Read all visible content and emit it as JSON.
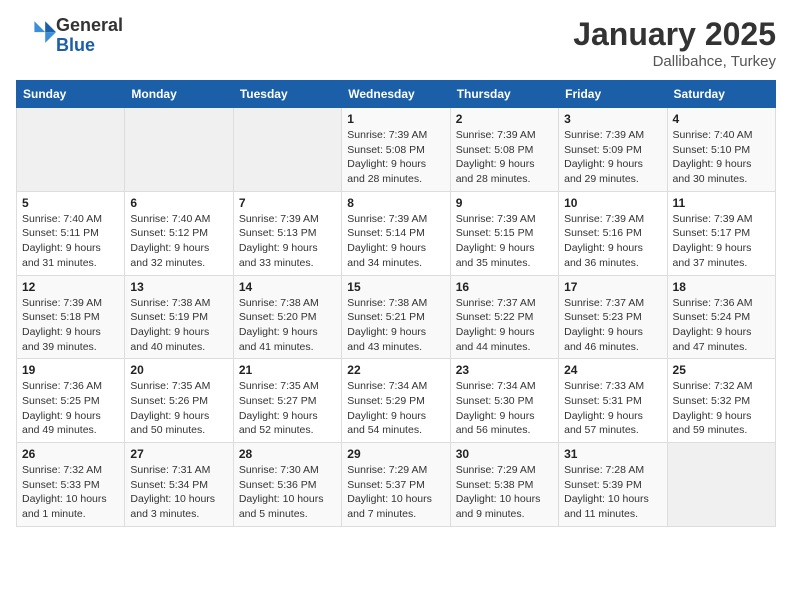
{
  "header": {
    "logo_line1": "General",
    "logo_line2": "Blue",
    "month": "January 2025",
    "location": "Dallibahce, Turkey"
  },
  "weekdays": [
    "Sunday",
    "Monday",
    "Tuesday",
    "Wednesday",
    "Thursday",
    "Friday",
    "Saturday"
  ],
  "weeks": [
    [
      {
        "day": "",
        "sunrise": "",
        "sunset": "",
        "daylight": ""
      },
      {
        "day": "",
        "sunrise": "",
        "sunset": "",
        "daylight": ""
      },
      {
        "day": "",
        "sunrise": "",
        "sunset": "",
        "daylight": ""
      },
      {
        "day": "1",
        "sunrise": "Sunrise: 7:39 AM",
        "sunset": "Sunset: 5:08 PM",
        "daylight": "Daylight: 9 hours and 28 minutes."
      },
      {
        "day": "2",
        "sunrise": "Sunrise: 7:39 AM",
        "sunset": "Sunset: 5:08 PM",
        "daylight": "Daylight: 9 hours and 28 minutes."
      },
      {
        "day": "3",
        "sunrise": "Sunrise: 7:39 AM",
        "sunset": "Sunset: 5:09 PM",
        "daylight": "Daylight: 9 hours and 29 minutes."
      },
      {
        "day": "4",
        "sunrise": "Sunrise: 7:40 AM",
        "sunset": "Sunset: 5:10 PM",
        "daylight": "Daylight: 9 hours and 30 minutes."
      }
    ],
    [
      {
        "day": "5",
        "sunrise": "Sunrise: 7:40 AM",
        "sunset": "Sunset: 5:11 PM",
        "daylight": "Daylight: 9 hours and 31 minutes."
      },
      {
        "day": "6",
        "sunrise": "Sunrise: 7:40 AM",
        "sunset": "Sunset: 5:12 PM",
        "daylight": "Daylight: 9 hours and 32 minutes."
      },
      {
        "day": "7",
        "sunrise": "Sunrise: 7:39 AM",
        "sunset": "Sunset: 5:13 PM",
        "daylight": "Daylight: 9 hours and 33 minutes."
      },
      {
        "day": "8",
        "sunrise": "Sunrise: 7:39 AM",
        "sunset": "Sunset: 5:14 PM",
        "daylight": "Daylight: 9 hours and 34 minutes."
      },
      {
        "day": "9",
        "sunrise": "Sunrise: 7:39 AM",
        "sunset": "Sunset: 5:15 PM",
        "daylight": "Daylight: 9 hours and 35 minutes."
      },
      {
        "day": "10",
        "sunrise": "Sunrise: 7:39 AM",
        "sunset": "Sunset: 5:16 PM",
        "daylight": "Daylight: 9 hours and 36 minutes."
      },
      {
        "day": "11",
        "sunrise": "Sunrise: 7:39 AM",
        "sunset": "Sunset: 5:17 PM",
        "daylight": "Daylight: 9 hours and 37 minutes."
      }
    ],
    [
      {
        "day": "12",
        "sunrise": "Sunrise: 7:39 AM",
        "sunset": "Sunset: 5:18 PM",
        "daylight": "Daylight: 9 hours and 39 minutes."
      },
      {
        "day": "13",
        "sunrise": "Sunrise: 7:38 AM",
        "sunset": "Sunset: 5:19 PM",
        "daylight": "Daylight: 9 hours and 40 minutes."
      },
      {
        "day": "14",
        "sunrise": "Sunrise: 7:38 AM",
        "sunset": "Sunset: 5:20 PM",
        "daylight": "Daylight: 9 hours and 41 minutes."
      },
      {
        "day": "15",
        "sunrise": "Sunrise: 7:38 AM",
        "sunset": "Sunset: 5:21 PM",
        "daylight": "Daylight: 9 hours and 43 minutes."
      },
      {
        "day": "16",
        "sunrise": "Sunrise: 7:37 AM",
        "sunset": "Sunset: 5:22 PM",
        "daylight": "Daylight: 9 hours and 44 minutes."
      },
      {
        "day": "17",
        "sunrise": "Sunrise: 7:37 AM",
        "sunset": "Sunset: 5:23 PM",
        "daylight": "Daylight: 9 hours and 46 minutes."
      },
      {
        "day": "18",
        "sunrise": "Sunrise: 7:36 AM",
        "sunset": "Sunset: 5:24 PM",
        "daylight": "Daylight: 9 hours and 47 minutes."
      }
    ],
    [
      {
        "day": "19",
        "sunrise": "Sunrise: 7:36 AM",
        "sunset": "Sunset: 5:25 PM",
        "daylight": "Daylight: 9 hours and 49 minutes."
      },
      {
        "day": "20",
        "sunrise": "Sunrise: 7:35 AM",
        "sunset": "Sunset: 5:26 PM",
        "daylight": "Daylight: 9 hours and 50 minutes."
      },
      {
        "day": "21",
        "sunrise": "Sunrise: 7:35 AM",
        "sunset": "Sunset: 5:27 PM",
        "daylight": "Daylight: 9 hours and 52 minutes."
      },
      {
        "day": "22",
        "sunrise": "Sunrise: 7:34 AM",
        "sunset": "Sunset: 5:29 PM",
        "daylight": "Daylight: 9 hours and 54 minutes."
      },
      {
        "day": "23",
        "sunrise": "Sunrise: 7:34 AM",
        "sunset": "Sunset: 5:30 PM",
        "daylight": "Daylight: 9 hours and 56 minutes."
      },
      {
        "day": "24",
        "sunrise": "Sunrise: 7:33 AM",
        "sunset": "Sunset: 5:31 PM",
        "daylight": "Daylight: 9 hours and 57 minutes."
      },
      {
        "day": "25",
        "sunrise": "Sunrise: 7:32 AM",
        "sunset": "Sunset: 5:32 PM",
        "daylight": "Daylight: 9 hours and 59 minutes."
      }
    ],
    [
      {
        "day": "26",
        "sunrise": "Sunrise: 7:32 AM",
        "sunset": "Sunset: 5:33 PM",
        "daylight": "Daylight: 10 hours and 1 minute."
      },
      {
        "day": "27",
        "sunrise": "Sunrise: 7:31 AM",
        "sunset": "Sunset: 5:34 PM",
        "daylight": "Daylight: 10 hours and 3 minutes."
      },
      {
        "day": "28",
        "sunrise": "Sunrise: 7:30 AM",
        "sunset": "Sunset: 5:36 PM",
        "daylight": "Daylight: 10 hours and 5 minutes."
      },
      {
        "day": "29",
        "sunrise": "Sunrise: 7:29 AM",
        "sunset": "Sunset: 5:37 PM",
        "daylight": "Daylight: 10 hours and 7 minutes."
      },
      {
        "day": "30",
        "sunrise": "Sunrise: 7:29 AM",
        "sunset": "Sunset: 5:38 PM",
        "daylight": "Daylight: 10 hours and 9 minutes."
      },
      {
        "day": "31",
        "sunrise": "Sunrise: 7:28 AM",
        "sunset": "Sunset: 5:39 PM",
        "daylight": "Daylight: 10 hours and 11 minutes."
      },
      {
        "day": "",
        "sunrise": "",
        "sunset": "",
        "daylight": ""
      }
    ]
  ]
}
